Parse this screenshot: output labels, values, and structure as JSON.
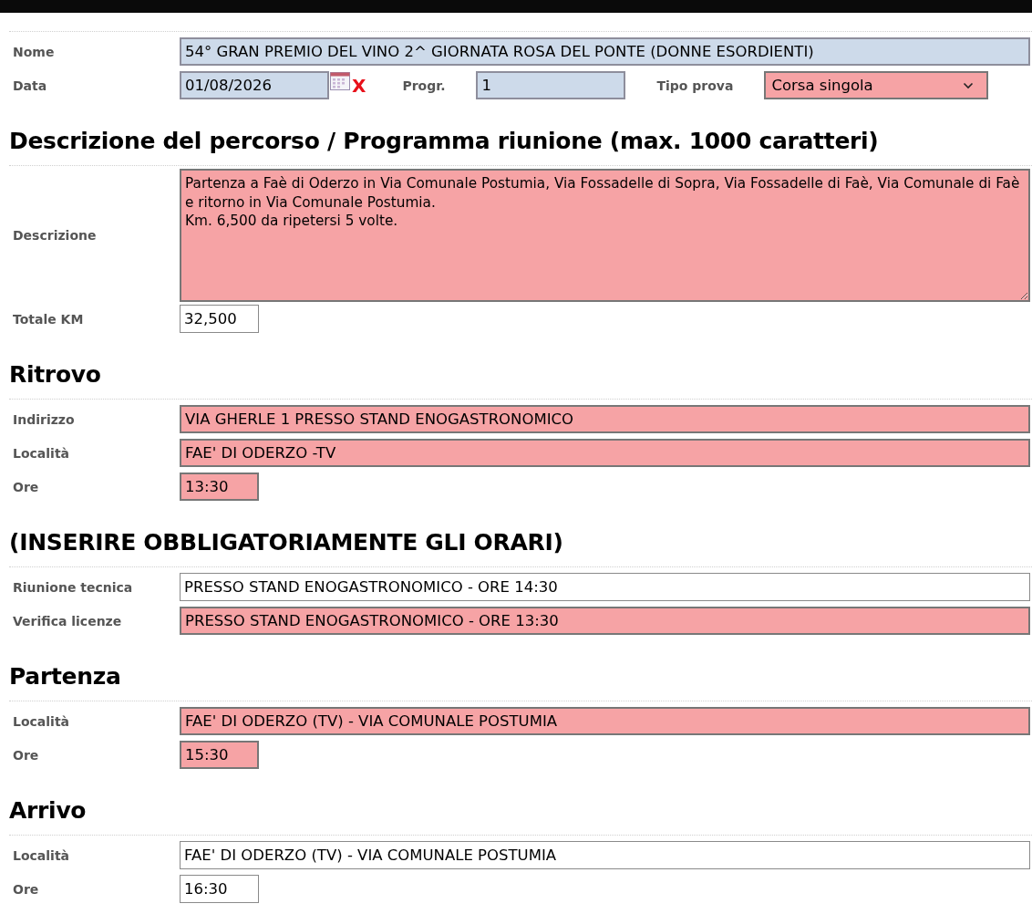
{
  "sections": [
    {
      "rows": [
        {
          "label": "Nome",
          "controls": [
            {
              "kind": "wide",
              "readonly": true,
              "required": false,
              "value": "54° GRAN PREMIO DEL VINO 2^ GIORNATA ROSA DEL PONTE (DONNE ESORDIENTI)"
            }
          ]
        },
        {
          "label": "Data",
          "controls": [
            {
              "kind": "date",
              "readonly": true,
              "required": false,
              "value": "01/08/2026"
            },
            {
              "kind": "clear",
              "text": "X"
            },
            {
              "kind": "label",
              "text": "Progr."
            },
            {
              "kind": "medium",
              "readonly": true,
              "required": false,
              "value": "1"
            },
            {
              "kind": "label",
              "text": "Tipo prova"
            },
            {
              "kind": "select",
              "readonly": false,
              "required": true,
              "value": "Corsa singola"
            }
          ]
        }
      ]
    },
    {
      "heading": "Descrizione del percorso / Programma riunione (max. 1000 caratteri)",
      "rows": [
        {
          "label": "Descrizione",
          "controls": [
            {
              "kind": "textarea",
              "readonly": false,
              "required": true,
              "value": "Partenza a Faè di Oderzo in Via Comunale Postumia, Via Fossadelle di Sopra, Via Fossadelle di Faè, Via Comunale di Faè e ritorno in Via Comunale Postumia.\nKm. 6,500 da ripetersi 5 volte."
            }
          ]
        },
        {
          "label": "Totale KM",
          "controls": [
            {
              "kind": "short",
              "readonly": false,
              "required": false,
              "value": "32,500"
            }
          ]
        }
      ]
    },
    {
      "heading": "Ritrovo",
      "rows": [
        {
          "label": "Indirizzo",
          "controls": [
            {
              "kind": "wide",
              "readonly": false,
              "required": true,
              "value": "VIA GHERLE 1 PRESSO STAND ENOGASTRONOMICO"
            }
          ]
        },
        {
          "label": "Località",
          "controls": [
            {
              "kind": "wide",
              "readonly": false,
              "required": true,
              "value": "FAE' DI ODERZO -TV"
            }
          ]
        },
        {
          "label": "Ore",
          "controls": [
            {
              "kind": "short",
              "readonly": false,
              "required": true,
              "value": "13:30"
            }
          ]
        }
      ]
    },
    {
      "heading": "(INSERIRE OBBLIGATORIAMENTE GLI ORARI)",
      "rows": [
        {
          "label": "Riunione tecnica",
          "controls": [
            {
              "kind": "wide",
              "readonly": false,
              "required": false,
              "value": "PRESSO STAND ENOGASTRONOMICO - ORE 14:30"
            }
          ]
        },
        {
          "label": "Verifica licenze",
          "controls": [
            {
              "kind": "wide",
              "readonly": false,
              "required": true,
              "value": "PRESSO STAND ENOGASTRONOMICO - ORE 13:30"
            }
          ]
        }
      ]
    },
    {
      "heading": "Partenza",
      "rows": [
        {
          "label": "Località",
          "controls": [
            {
              "kind": "wide",
              "readonly": false,
              "required": true,
              "value": "FAE' DI ODERZO (TV) - VIA COMUNALE POSTUMIA"
            }
          ]
        },
        {
          "label": "Ore",
          "controls": [
            {
              "kind": "short",
              "readonly": false,
              "required": true,
              "value": "15:30"
            }
          ]
        }
      ]
    },
    {
      "heading": "Arrivo",
      "rows": [
        {
          "label": "Località",
          "controls": [
            {
              "kind": "wide",
              "readonly": false,
              "required": false,
              "value": "FAE' DI ODERZO (TV) - VIA COMUNALE POSTUMIA"
            }
          ]
        },
        {
          "label": "Ore",
          "controls": [
            {
              "kind": "short",
              "readonly": false,
              "required": false,
              "value": "16:30"
            }
          ]
        }
      ]
    }
  ]
}
